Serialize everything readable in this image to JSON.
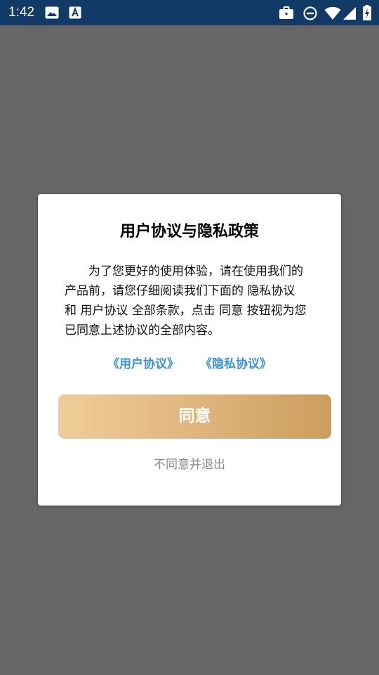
{
  "status_bar": {
    "time": "1:42",
    "icons": [
      "image-icon",
      "text-a-icon",
      "briefcase-icon",
      "do-not-disturb-icon",
      "wifi-icon",
      "signal-icon",
      "battery-charging-icon"
    ]
  },
  "dialog": {
    "title": "用户协议与隐私政策",
    "body": "为了您更好的使用体验，请在使用我们的产品前，请您仔细阅读我们下面的 隐私协议 和 用户协议 全部条款，点击 同意 按钮视为您已同意上述协议的全部内容。",
    "link_user_agreement": "《用户协议》",
    "link_privacy": "《隐私协议》",
    "agree_label": "同意",
    "disagree_label": "不同意并退出"
  },
  "colors": {
    "status_bar": "#123a67",
    "scrim": "#666666",
    "link": "#3a93d6",
    "button_start": "#f0cd98",
    "button_end": "#cb9d5d",
    "secondary_text": "#8a8a8a"
  }
}
